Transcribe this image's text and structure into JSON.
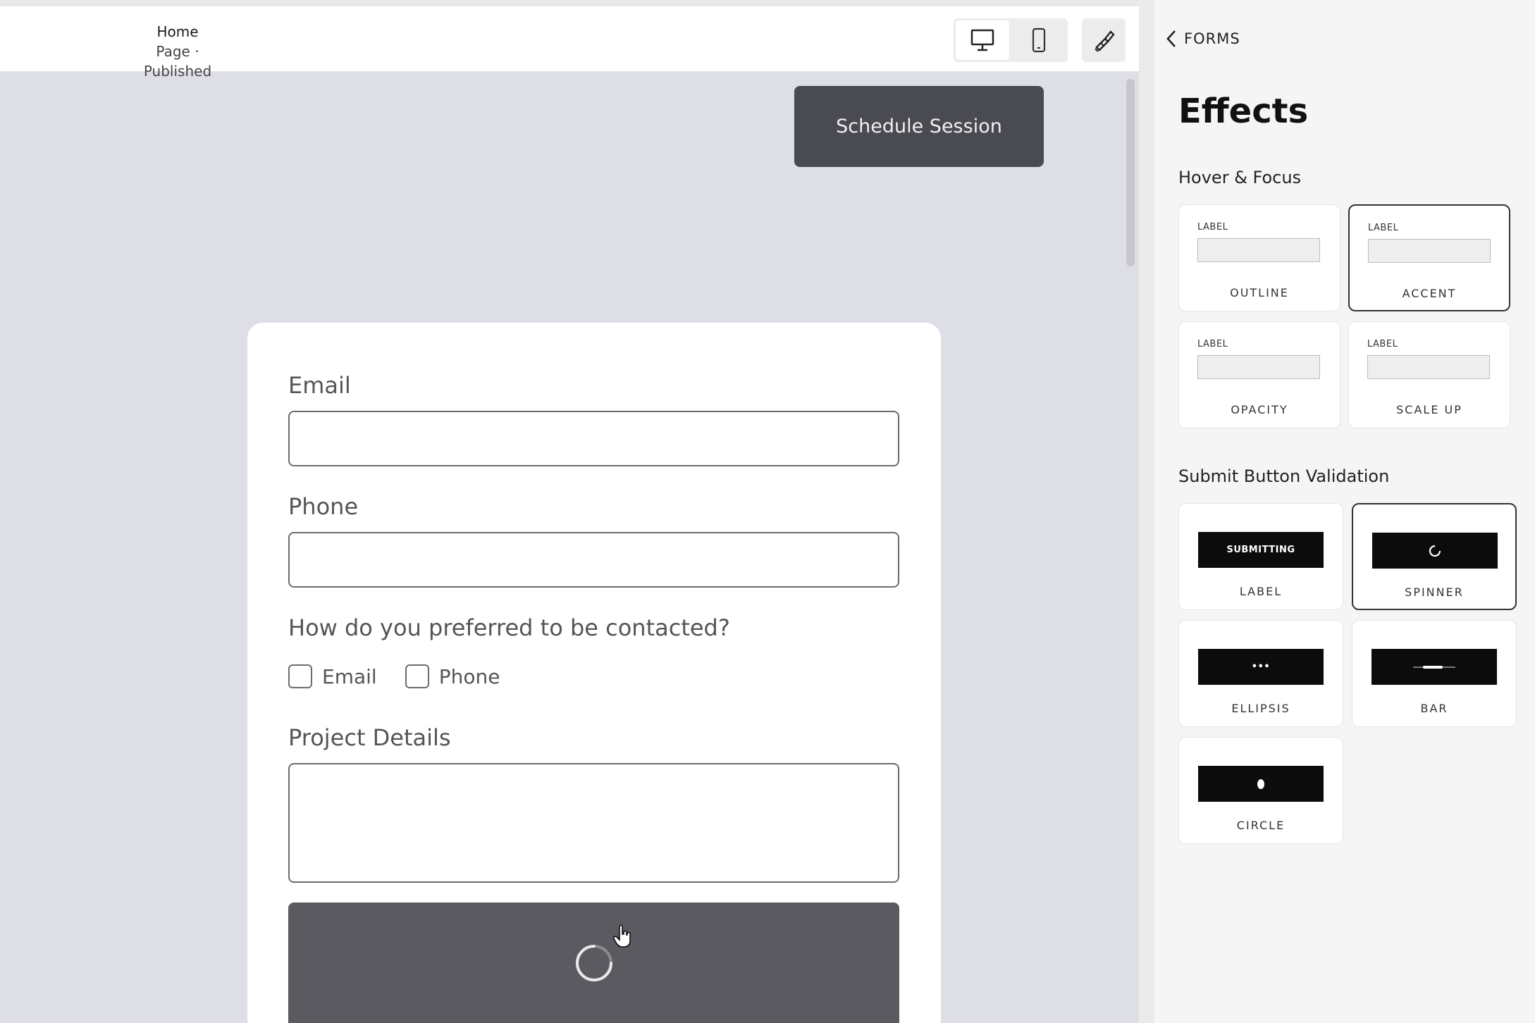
{
  "topbar": {
    "page_title": "Home",
    "page_status": "Page · Published",
    "desktop_icon": "desktop-icon",
    "mobile_icon": "mobile-icon",
    "brush_icon": "paintbrush-icon"
  },
  "canvas": {
    "schedule_button": "Schedule Session",
    "form": {
      "email_label": "Email",
      "phone_label": "Phone",
      "contact_question": "How do you preferred to be contacted?",
      "contact_options": [
        "Email",
        "Phone"
      ],
      "project_label": "Project Details",
      "submit_state": "spinner"
    }
  },
  "panel": {
    "back_label": "FORMS",
    "title": "Effects",
    "hover_section": "Hover & Focus",
    "hover_options": [
      {
        "preview_label": "LABEL",
        "name": "OUTLINE",
        "selected": false
      },
      {
        "preview_label": "LABEL",
        "name": "ACCENT",
        "selected": true
      },
      {
        "preview_label": "LABEL",
        "name": "OPACITY",
        "selected": false
      },
      {
        "preview_label": "LABEL",
        "name": "SCALE UP",
        "selected": false
      }
    ],
    "validation_section": "Submit Button Validation",
    "validation_options": [
      {
        "preview_text": "SUBMITTING",
        "name": "LABEL",
        "selected": false
      },
      {
        "preview_text": "",
        "name": "SPINNER",
        "selected": true
      },
      {
        "preview_text": "•••",
        "name": "ELLIPSIS",
        "selected": false
      },
      {
        "preview_text": "",
        "name": "BAR",
        "selected": false
      },
      {
        "preview_text": "",
        "name": "CIRCLE",
        "selected": false
      }
    ]
  },
  "colors": {
    "canvas_bg": "#dedee6",
    "dark_button": "#4a4a52",
    "submit_button": "#5a5a60"
  }
}
